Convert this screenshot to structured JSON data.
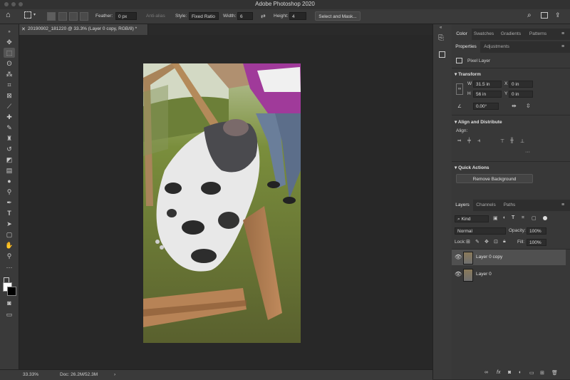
{
  "app": {
    "title": "Adobe Photoshop 2020"
  },
  "options": {
    "feather_label": "Feather:",
    "feather_value": "0 px",
    "antialias_label": "Anti-alias",
    "style_label": "Style:",
    "style_value": "Fixed Ratio",
    "width_label": "Width:",
    "width_value": "6",
    "height_label": "Height:",
    "height_value": "4",
    "select_mask_label": "Select and Mask..."
  },
  "document": {
    "tab_title": "20190902_181220 @ 33.3% (Layer 0 copy, RGB/8) *"
  },
  "status": {
    "zoom": "33.33%",
    "doc": "Doc: 26.2M/52.3M"
  },
  "top_panel": {
    "tabs": [
      "Color",
      "Swatches",
      "Gradients",
      "Patterns"
    ]
  },
  "properties": {
    "tabs": [
      "Properties",
      "Adjustments"
    ],
    "layer_type": "Pixel Layer",
    "transform_title": "Transform",
    "w_label": "W",
    "w_value": "31.5 in",
    "h_label": "H",
    "h_value": "56 in",
    "x_label": "X",
    "x_value": "0 in",
    "y_label": "Y",
    "y_value": "0 in",
    "angle_value": "0.00°",
    "align_title": "Align and Distribute",
    "align_label": "Align:",
    "quick_title": "Quick Actions",
    "remove_bg_label": "Remove Background"
  },
  "layers_panel": {
    "tabs": [
      "Layers",
      "Channels",
      "Paths"
    ],
    "kind_label": "Kind",
    "blend_mode": "Normal",
    "opacity_label": "Opacity:",
    "opacity_value": "100%",
    "lock_label": "Lock:",
    "fill_label": "Fill:",
    "fill_value": "100%",
    "layers": [
      {
        "name": "Layer 0 copy",
        "selected": true
      },
      {
        "name": "Layer 0",
        "selected": false
      }
    ]
  },
  "colors": {
    "accent": "#1473e6",
    "selected_row": "#505050"
  }
}
